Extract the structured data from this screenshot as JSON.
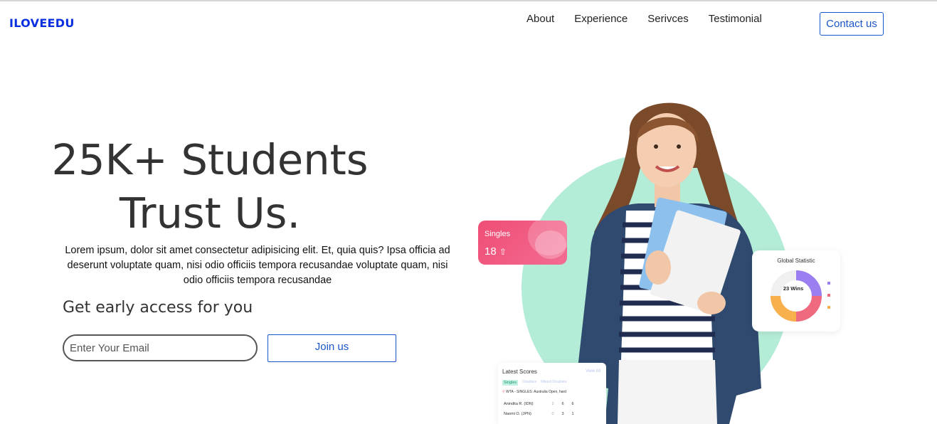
{
  "brand": {
    "logo": "ILOVEEDU"
  },
  "nav": {
    "items": [
      "About",
      "Experience",
      "Serivces",
      "Testimonial"
    ],
    "contact_label": "Contact us"
  },
  "hero": {
    "title_line1": "25K+ Students",
    "title_line2": "Trust Us.",
    "description": "Lorem ipsum, dolor sit amet consectetur adipisicing elit. Et, quia quis? Ipsa officia ad deserunt voluptate quam, nisi odio officiis tempora recusandae voluptate quam, nisi odio officiis tempora recusandae",
    "early_access": "Get early access for you",
    "email_placeholder": "Enter Your Email",
    "join_label": "Join us"
  },
  "illustration": {
    "singles_card": {
      "label": "Singles",
      "value": "18"
    },
    "global_card": {
      "label": "Global Statistic",
      "center": "23 Wins"
    },
    "scores_card": {
      "title": "Latest Scores",
      "view_all": "View All",
      "tabs": [
        "Singles",
        "Doubles",
        "Mixed Doubles"
      ],
      "event": "WTA - SINGLES: Australia Open, hard",
      "rows": [
        {
          "name": "Anindita R. (IDN)",
          "scores": [
            "2",
            "6",
            "6"
          ]
        },
        {
          "name": "Naomi O. (JPN)",
          "scores": [
            "0",
            "3",
            "1"
          ]
        }
      ]
    },
    "colors": {
      "circle": "#b3ecd7",
      "singles_card": "#ef4e75",
      "accent_blue": "#1a56c9"
    }
  }
}
